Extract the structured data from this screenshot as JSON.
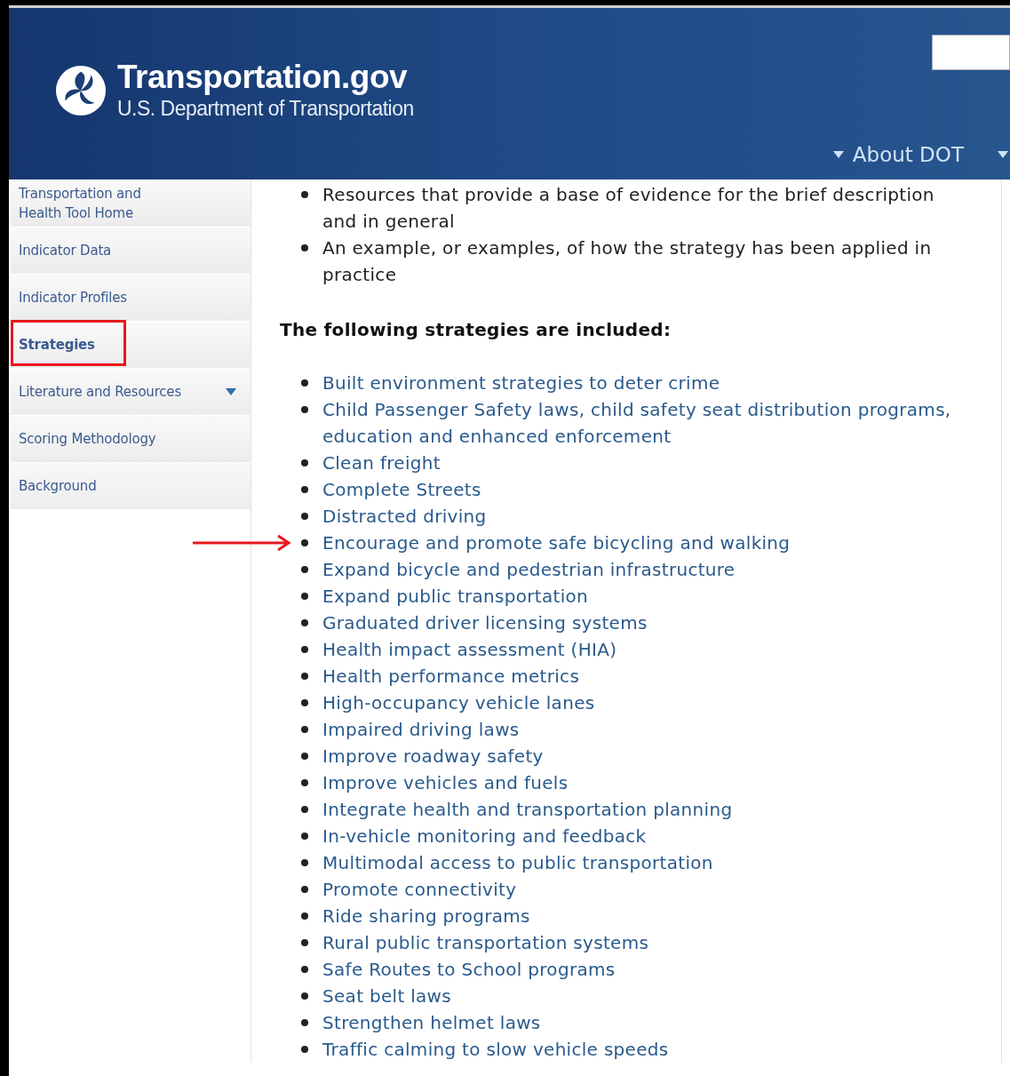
{
  "header": {
    "site_name": "Transportation.gov",
    "department": "U.S. Department of Transportation",
    "nav": [
      {
        "kind": "link",
        "label": "About DOT"
      },
      {
        "kind": "cut_off"
      }
    ]
  },
  "sidebar": {
    "items": [
      {
        "label": "Transportation and Health Tool Home",
        "selected": false,
        "highlighted": false,
        "has_submenu": false
      },
      {
        "label": "Indicator Data",
        "selected": false,
        "highlighted": false,
        "has_submenu": false
      },
      {
        "label": "Indicator Profiles",
        "selected": false,
        "highlighted": false,
        "has_submenu": false
      },
      {
        "label": "Strategies",
        "selected": true,
        "highlighted": true,
        "has_submenu": false
      },
      {
        "label": "Literature and Resources",
        "selected": false,
        "highlighted": false,
        "has_submenu": true
      },
      {
        "label": "Scoring Methodology",
        "selected": false,
        "highlighted": false,
        "has_submenu": false
      },
      {
        "label": "Background",
        "selected": false,
        "highlighted": false,
        "has_submenu": false
      }
    ]
  },
  "content": {
    "intro_bullets": [
      "Resources that provide a base of evidence for the brief description and in general",
      "An example, or examples, of how the strategy has been applied in practice"
    ],
    "heading": "The following strategies are included:",
    "strategies": [
      {
        "label": "Built environment strategies to deter crime",
        "pointed": false
      },
      {
        "label": "Child Passenger Safety laws, child safety seat distribution programs, education and enhanced enforcement",
        "pointed": false
      },
      {
        "label": "Clean freight",
        "pointed": false
      },
      {
        "label": "Complete Streets",
        "pointed": false
      },
      {
        "label": "Distracted driving",
        "pointed": false
      },
      {
        "label": "Encourage and promote safe bicycling and walking",
        "pointed": true
      },
      {
        "label": "Expand bicycle and pedestrian infrastructure",
        "pointed": false
      },
      {
        "label": "Expand public transportation",
        "pointed": false
      },
      {
        "label": "Graduated driver licensing systems",
        "pointed": false
      },
      {
        "label": "Health impact assessment (HIA)",
        "pointed": false
      },
      {
        "label": "Health performance metrics",
        "pointed": false
      },
      {
        "label": "High-occupancy vehicle lanes",
        "pointed": false
      },
      {
        "label": "Impaired driving laws",
        "pointed": false
      },
      {
        "label": "Improve roadway safety",
        "pointed": false
      },
      {
        "label": "Improve vehicles and fuels",
        "pointed": false
      },
      {
        "label": "Integrate health and transportation planning",
        "pointed": false
      },
      {
        "label": "In-vehicle monitoring and feedback",
        "pointed": false
      },
      {
        "label": "Multimodal access to public transportation",
        "pointed": false
      },
      {
        "label": "Promote connectivity",
        "pointed": false
      },
      {
        "label": "Ride sharing programs",
        "pointed": false
      },
      {
        "label": "Rural public transportation systems",
        "pointed": false
      },
      {
        "label": "Safe Routes to School programs",
        "pointed": false
      },
      {
        "label": "Seat belt laws",
        "pointed": false
      },
      {
        "label": "Strengthen helmet laws",
        "pointed": false
      },
      {
        "label": "Traffic calming to slow vehicle speeds",
        "pointed": false
      }
    ]
  }
}
